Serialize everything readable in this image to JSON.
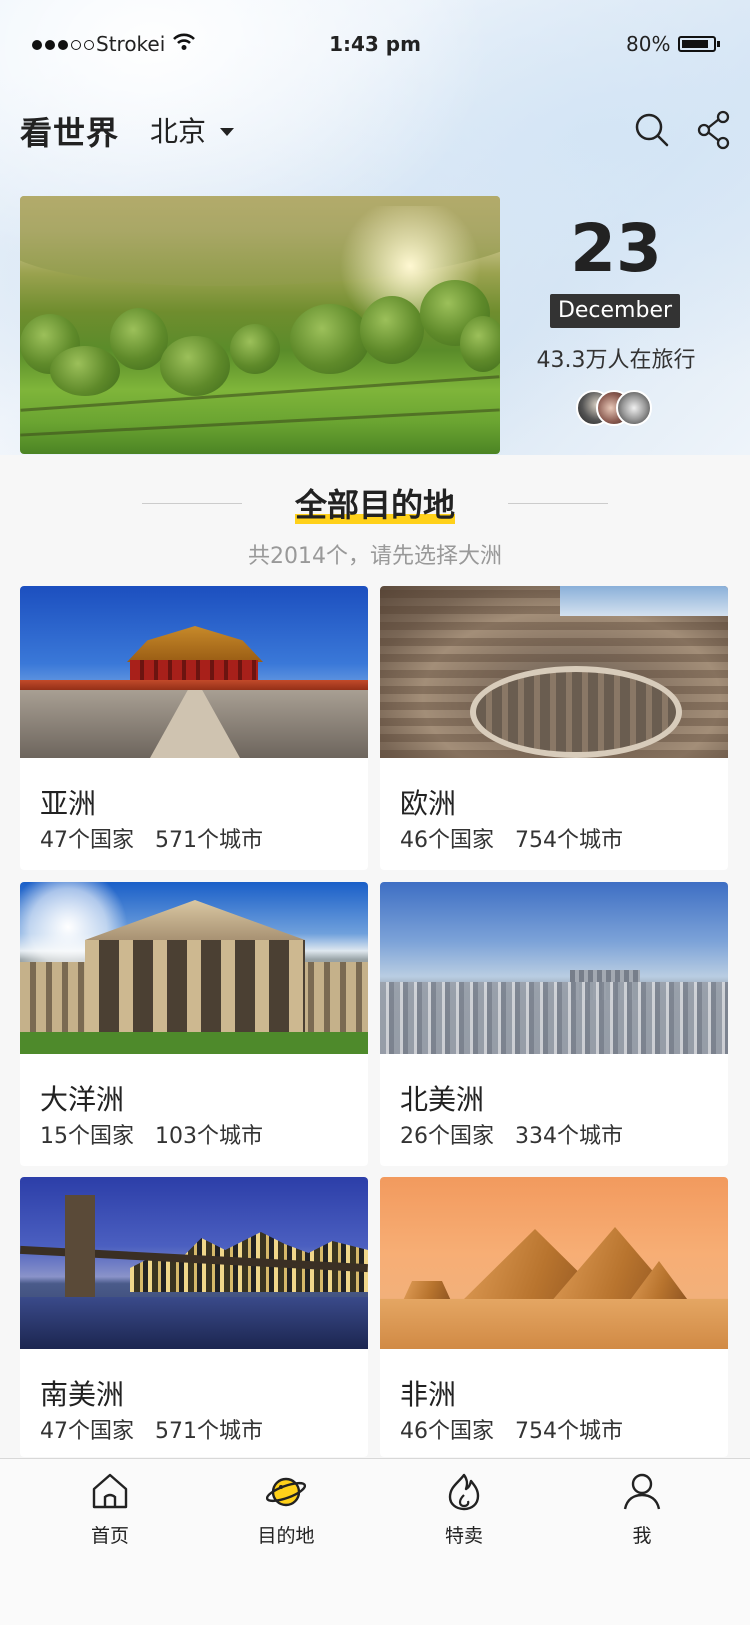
{
  "status_bar": {
    "carrier": "Strokei",
    "time": "1:43 pm",
    "battery": "80%",
    "battery_level": 0.8
  },
  "header": {
    "title": "看世界",
    "city": "北京",
    "icons": [
      "search-icon",
      "share-icon"
    ]
  },
  "date_panel": {
    "day": "23",
    "month": "December",
    "travelers": "43.3万人在旅行"
  },
  "section": {
    "title": "全部目的地",
    "subtitle": "共2014个，请先选择大洲"
  },
  "continents": [
    {
      "name": "亚洲",
      "stats": "47个国家   571个城市"
    },
    {
      "name": "欧洲",
      "stats": "46个国家   754个城市"
    },
    {
      "name": "大洋洲",
      "stats": "15个国家   103个城市"
    },
    {
      "name": "北美洲",
      "stats": "26个国家   334个城市"
    },
    {
      "name": "南美洲",
      "stats": "47个国家   571个城市"
    },
    {
      "name": "非洲",
      "stats": "46个国家   754个城市"
    }
  ],
  "tabs": [
    {
      "label": "首页",
      "icon": "home-icon"
    },
    {
      "label": "目的地",
      "icon": "planet-icon",
      "active": true
    },
    {
      "label": "特卖",
      "icon": "flame-icon"
    },
    {
      "label": "我",
      "icon": "user-icon"
    }
  ],
  "colors": {
    "accent": "#ffd11a",
    "text": "#222222",
    "muted": "#999999"
  }
}
